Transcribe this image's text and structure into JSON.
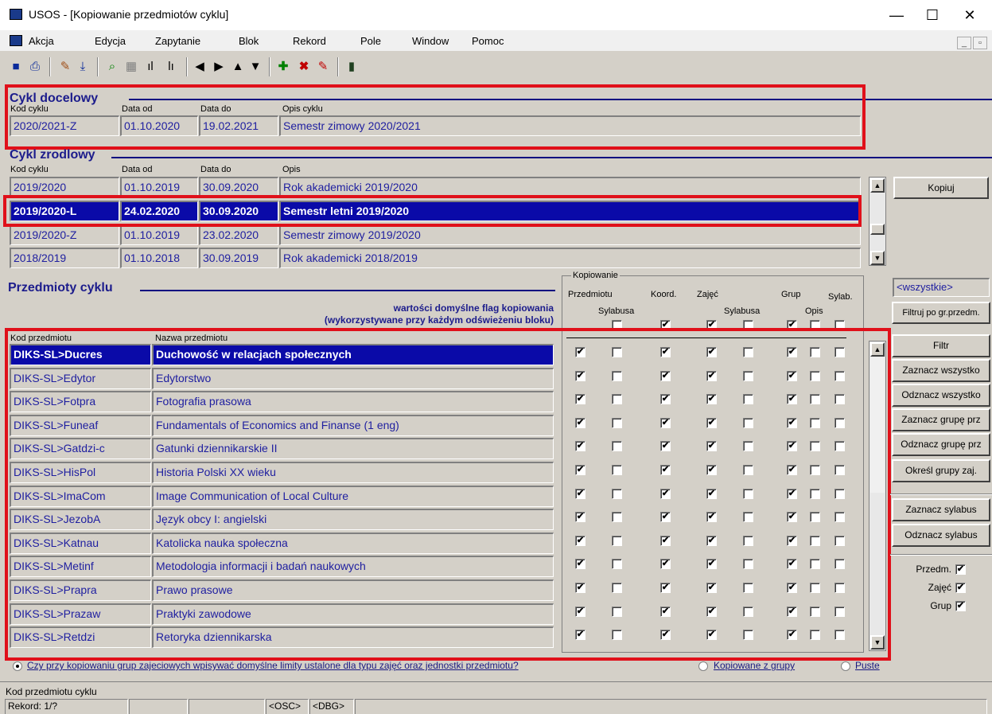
{
  "window": {
    "title": "USOS - [Kopiowanie przedmiotów cyklu]",
    "minimize": "—",
    "maximize": "☐",
    "close": "✕"
  },
  "menu": {
    "items": [
      "Akcja",
      "Edycja",
      "Zapytanie",
      "Blok",
      "Rekord",
      "Pole",
      "Window",
      "Pomoc"
    ]
  },
  "target_cycle": {
    "section_title": "Cykl docelowy",
    "headers": {
      "code": "Kod cyklu",
      "from": "Data od",
      "to": "Data do",
      "desc": "Opis cyklu"
    },
    "code": "2020/2021-Z",
    "from": "01.10.2020",
    "to": "19.02.2021",
    "desc": "Semestr zimowy 2020/2021"
  },
  "source_cycle": {
    "section_title": "Cykl zrodlowy",
    "headers": {
      "code": "Kod cyklu",
      "from": "Data od",
      "to": "Data do",
      "desc": "Opis"
    },
    "rows": [
      {
        "code": "2019/2020",
        "from": "01.10.2019",
        "to": "30.09.2020",
        "desc": "Rok akademicki 2019/2020"
      },
      {
        "code": "2019/2020-L",
        "from": "24.02.2020",
        "to": "30.09.2020",
        "desc": "Semestr letni 2019/2020"
      },
      {
        "code": "2019/2020-Z",
        "from": "01.10.2019",
        "to": "23.02.2020",
        "desc": "Semestr zimowy 2019/2020"
      },
      {
        "code": "2018/2019",
        "from": "01.10.2018",
        "to": "30.09.2019",
        "desc": "Rok akademicki 2018/2019"
      }
    ],
    "selected_index": 1
  },
  "subjects": {
    "section_title": "Przedmioty cyklu",
    "defaults_note_1": "wartości domyślne flag kopiowania",
    "defaults_note_2": "(wykorzystywane przy każdym odświeżeniu bloku)",
    "headers": {
      "code": "Kod przedmiotu",
      "name": "Nazwa przedmiotu"
    },
    "copy_group_title": "Kopiowanie",
    "col_headers": {
      "przedmiotu": "Przedmiotu",
      "sylabusa_1": "Sylabusa",
      "koord": "Koord.",
      "zajec": "Zajęć",
      "sylabusa_2": "Sylabusa",
      "grup": "Grup",
      "opis": "Opis",
      "sylab": "Sylab."
    },
    "default_flags": [
      false,
      true,
      true,
      false,
      true,
      false,
      false
    ],
    "rows": [
      {
        "code": "DIKS-SL>Ducres",
        "name": "Duchowość w relacjach społecznych",
        "flags": [
          true,
          false,
          true,
          true,
          false,
          true,
          false,
          false
        ]
      },
      {
        "code": "DIKS-SL>Edytor",
        "name": "Edytorstwo",
        "flags": [
          true,
          false,
          true,
          true,
          false,
          true,
          false,
          false
        ]
      },
      {
        "code": "DIKS-SL>Fotpra",
        "name": "Fotografia prasowa",
        "flags": [
          true,
          false,
          true,
          true,
          false,
          true,
          false,
          false
        ]
      },
      {
        "code": "DIKS-SL>Funeaf",
        "name": "Fundamentals of Economics and Finanse (1 eng)",
        "flags": [
          true,
          false,
          true,
          true,
          false,
          true,
          false,
          false
        ]
      },
      {
        "code": "DIKS-SL>Gatdzi-c",
        "name": "Gatunki dziennikarskie II",
        "flags": [
          true,
          false,
          true,
          true,
          false,
          true,
          false,
          false
        ]
      },
      {
        "code": "DIKS-SL>HisPol",
        "name": "Historia Polski XX wieku",
        "flags": [
          true,
          false,
          true,
          true,
          false,
          true,
          false,
          false
        ]
      },
      {
        "code": "DIKS-SL>ImaCom",
        "name": "Image Communication of Local Culture",
        "flags": [
          true,
          false,
          true,
          true,
          false,
          true,
          false,
          false
        ]
      },
      {
        "code": "DIKS-SL>JezobA",
        "name": "Język obcy I: angielski",
        "flags": [
          true,
          false,
          true,
          true,
          false,
          true,
          false,
          false
        ]
      },
      {
        "code": "DIKS-SL>Katnau",
        "name": "Katolicka nauka społeczna",
        "flags": [
          true,
          false,
          true,
          true,
          false,
          true,
          false,
          false
        ]
      },
      {
        "code": "DIKS-SL>Metinf",
        "name": "Metodologia informacji i badań naukowych",
        "flags": [
          true,
          false,
          true,
          true,
          false,
          true,
          false,
          false
        ]
      },
      {
        "code": "DIKS-SL>Prapra",
        "name": "Prawo prasowe",
        "flags": [
          true,
          false,
          true,
          true,
          false,
          true,
          false,
          false
        ]
      },
      {
        "code": "DIKS-SL>Prazaw",
        "name": "Praktyki zawodowe",
        "flags": [
          true,
          false,
          true,
          true,
          false,
          true,
          false,
          false
        ]
      },
      {
        "code": "DIKS-SL>Retdzi",
        "name": "Retoryka dziennikarska",
        "flags": [
          true,
          false,
          true,
          true,
          false,
          true,
          false,
          false
        ]
      }
    ],
    "selected_index": 0
  },
  "side": {
    "copy_button": "Kopiuj",
    "group_filter_value": "<wszystkie>",
    "filter_by_group": "Filtruj po gr.przedm.",
    "buttons": [
      "Filtr",
      "Zaznacz wszystko",
      "Odznacz wszystko",
      "Zaznacz grupę prz",
      "Odznacz grupę prz",
      "Określ grupy zaj."
    ],
    "syllabus_buttons": [
      "Zaznacz sylabus",
      "Odznacz sylabus"
    ],
    "toggles": [
      {
        "label": "Przedm.",
        "checked": true
      },
      {
        "label": "Zajęć",
        "checked": true
      },
      {
        "label": "Grup",
        "checked": true
      }
    ]
  },
  "limits": {
    "question": "Czy przy kopiowaniu grup zajeciowych wpisywać domyślne limity ustalone dla typu zajęć oraz jednostki przedmiotu?",
    "option_copied": "Kopiowane z grupy",
    "option_empty": "Puste",
    "selected": "question"
  },
  "status": {
    "field_hint": "Kod przedmiotu cyklu",
    "record": "Rekord: 1/?",
    "osc": "<OSC>",
    "dbg": "<DBG>"
  },
  "colors": {
    "selection": "#0a0aa8",
    "field_text": "#2020a0",
    "highlight_box": "#e0101a",
    "section_title": "#1c1c8c"
  }
}
